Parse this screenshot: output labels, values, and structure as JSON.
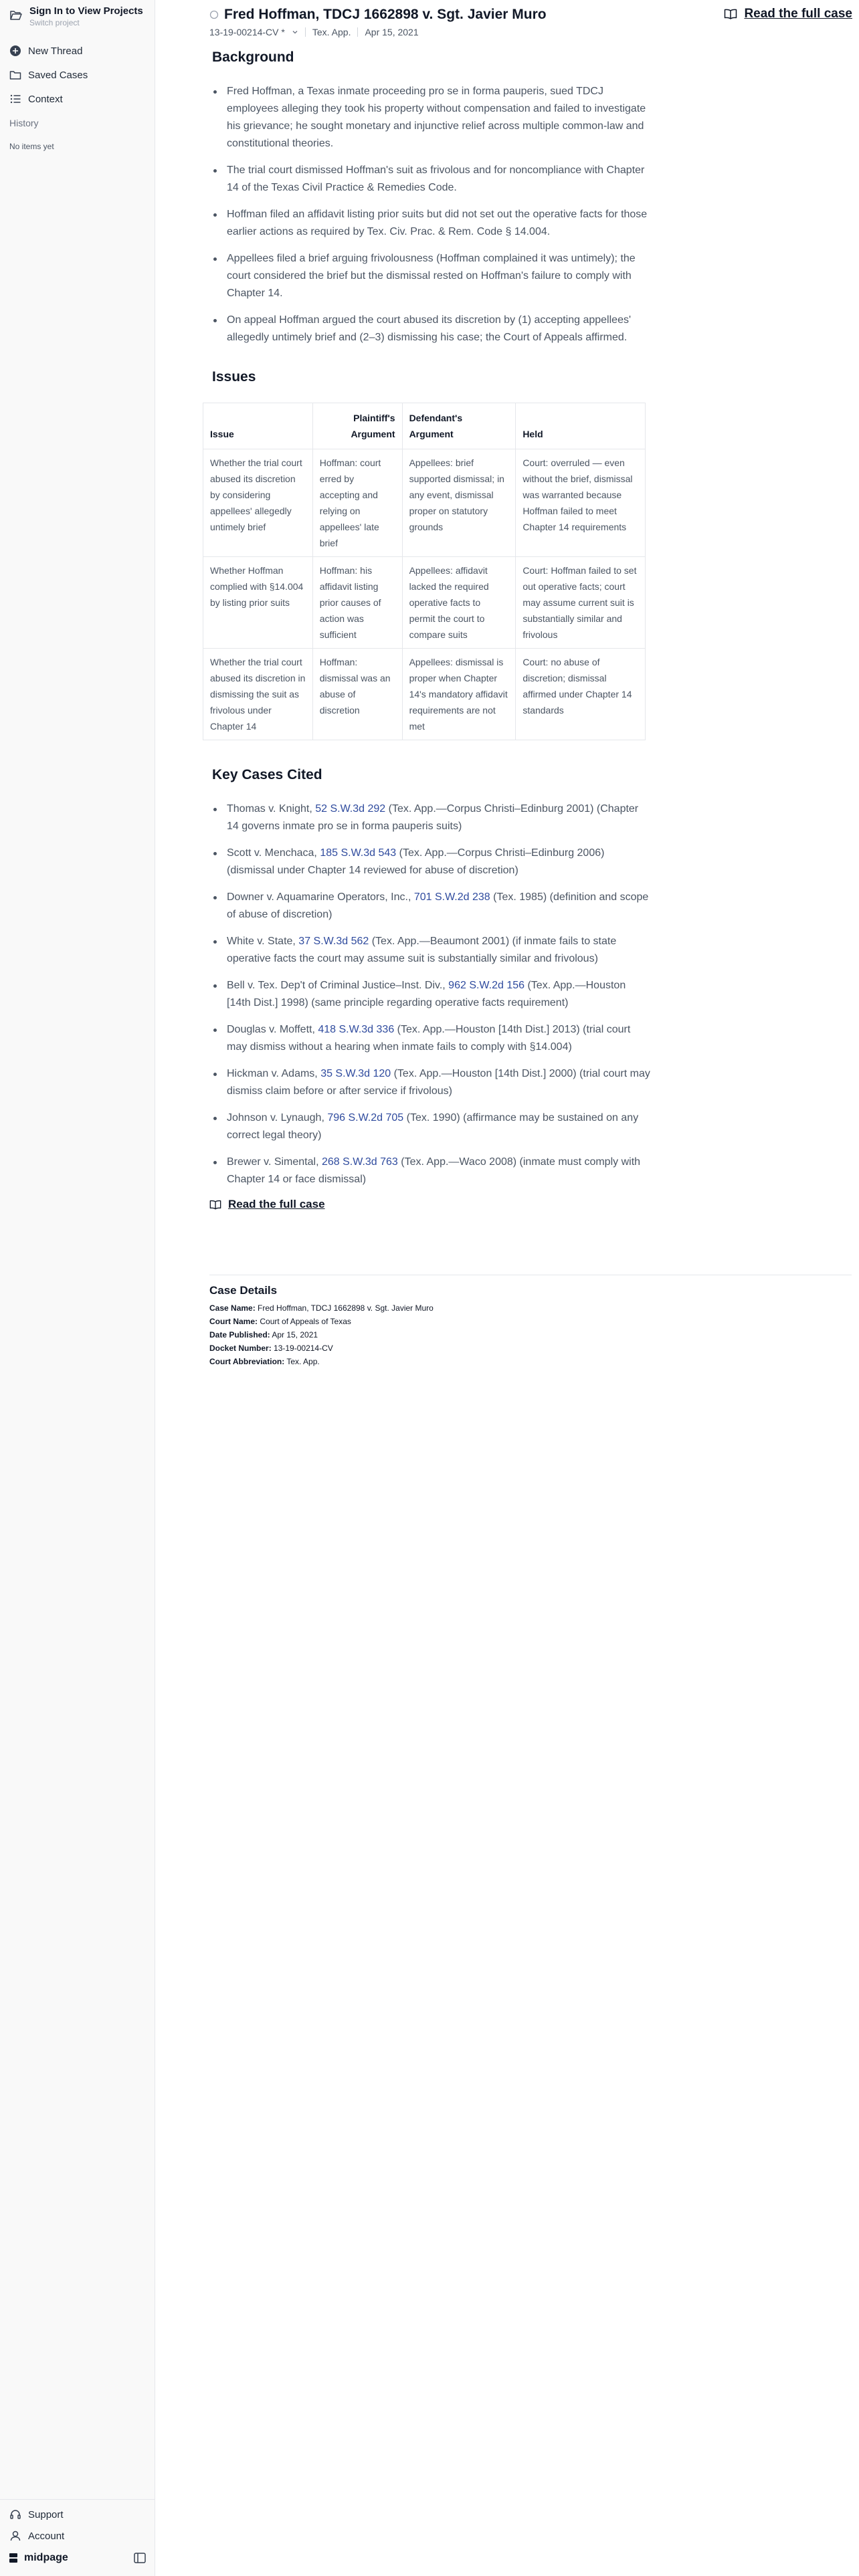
{
  "sidebar": {
    "project_title": "Sign In to View Projects",
    "project_sub": "Switch project",
    "nav": [
      {
        "label": "New Thread",
        "icon": "plus-circle-icon"
      },
      {
        "label": "Saved Cases",
        "icon": "folder-icon"
      },
      {
        "label": "Context",
        "icon": "list-icon"
      }
    ],
    "history_label": "History",
    "history_empty": "No items yet",
    "support": "Support",
    "account": "Account",
    "brand": "midpage"
  },
  "header": {
    "title": "Fred Hoffman, TDCJ 1662898 v. Sgt. Javier Muro",
    "docket": "13-19-00214-CV *",
    "court": "Tex. App.",
    "date": "Apr 15, 2021",
    "read_full": "Read the full case"
  },
  "background": {
    "heading": "Background",
    "items": [
      "Fred Hoffman, a Texas inmate proceeding pro se in forma pauperis, sued TDCJ employees alleging they took his property without compensation and failed to investigate his grievance; he sought monetary and injunctive relief across multiple common-law and constitutional theories.",
      "The trial court dismissed Hoffman's suit as frivolous and for noncompliance with Chapter 14 of the Texas Civil Practice & Remedies Code.",
      "Hoffman filed an affidavit listing prior suits but did not set out the operative facts for those earlier actions as required by Tex. Civ. Prac. & Rem. Code § 14.004.",
      "Appellees filed a brief arguing frivolousness (Hoffman complained it was untimely); the court considered the brief but the dismissal rested on Hoffman's failure to comply with Chapter 14.",
      "On appeal Hoffman argued the court abused its discretion by (1) accepting appellees' allegedly untimely brief and (2–3) dismissing his case; the Court of Appeals affirmed."
    ]
  },
  "issues": {
    "heading": "Issues",
    "headers": [
      "Issue",
      "Plaintiff's Argument",
      "Defendant's Argument",
      "Held"
    ],
    "rows": [
      [
        "Whether the trial court abused its discretion by considering appellees' allegedly untimely brief",
        "Hoffman: court erred by accepting and relying on appellees' late brief",
        "Appellees: brief supported dismissal; in any event, dismissal proper on statutory grounds",
        "Court: overruled — even without the brief, dismissal was warranted because Hoffman failed to meet Chapter 14 requirements"
      ],
      [
        "Whether Hoffman complied with §14.004 by listing prior suits",
        "Hoffman: his affidavit listing prior causes of action was sufficient",
        "Appellees: affidavit lacked the required operative facts to permit the court to compare suits",
        "Court: Hoffman failed to set out operative facts; court may assume current suit is substantially similar and frivolous"
      ],
      [
        "Whether the trial court abused its discretion in dismissing the suit as frivolous under Chapter 14",
        "Hoffman: dismissal was an abuse of discretion",
        "Appellees: dismissal is proper when Chapter 14's mandatory affidavit requirements are not met",
        "Court: no abuse of discretion; dismissal affirmed under Chapter 14 standards"
      ]
    ]
  },
  "key_cases": {
    "heading": "Key Cases Cited",
    "items": [
      {
        "name": "Thomas v. Knight, ",
        "cite": "52 S.W.3d 292",
        "rest": " (Tex. App.—Corpus Christi–Edinburg 2001) (Chapter 14 governs inmate pro se in forma pauperis suits)"
      },
      {
        "name": "Scott v. Menchaca, ",
        "cite": "185 S.W.3d 543",
        "rest": " (Tex. App.—Corpus Christi–Edinburg 2006) (dismissal under Chapter 14 reviewed for abuse of discretion)"
      },
      {
        "name": "Downer v. Aquamarine Operators, Inc., ",
        "cite": "701 S.W.2d 238",
        "rest": " (Tex. 1985) (definition and scope of abuse of discretion)"
      },
      {
        "name": "White v. State, ",
        "cite": "37 S.W.3d 562",
        "rest": " (Tex. App.—Beaumont 2001) (if inmate fails to state operative facts the court may assume suit is substantially similar and frivolous)"
      },
      {
        "name": "Bell v. Tex. Dep't of Criminal Justice–Inst. Div., ",
        "cite": "962 S.W.2d 156",
        "rest": " (Tex. App.—Houston [14th Dist.] 1998) (same principle regarding operative facts requirement)"
      },
      {
        "name": "Douglas v. Moffett, ",
        "cite": "418 S.W.3d 336",
        "rest": " (Tex. App.—Houston [14th Dist.] 2013) (trial court may dismiss without a hearing when inmate fails to comply with §14.004)"
      },
      {
        "name": "Hickman v. Adams, ",
        "cite": "35 S.W.3d 120",
        "rest": " (Tex. App.—Houston [14th Dist.] 2000) (trial court may dismiss claim before or after service if frivolous)"
      },
      {
        "name": "Johnson v. Lynaugh, ",
        "cite": "796 S.W.2d 705",
        "rest": " (Tex. 1990) (affirmance may be sustained on any correct legal theory)"
      },
      {
        "name": "Brewer v. Simental, ",
        "cite": "268 S.W.3d 763",
        "rest": " (Tex. App.—Waco 2008) (inmate must comply with Chapter 14 or face dismissal)"
      }
    ]
  },
  "read_full_bottom": "Read the full case",
  "case_details": {
    "heading": "Case Details",
    "rows": [
      {
        "label": "Case Name:",
        "value": "Fred Hoffman, TDCJ 1662898 v. Sgt. Javier Muro"
      },
      {
        "label": "Court Name:",
        "value": "Court of Appeals of Texas"
      },
      {
        "label": "Date Published:",
        "value": "Apr 15, 2021"
      },
      {
        "label": "Docket Number:",
        "value": "13-19-00214-CV"
      },
      {
        "label": "Court Abbreviation:",
        "value": "Tex. App."
      }
    ]
  }
}
